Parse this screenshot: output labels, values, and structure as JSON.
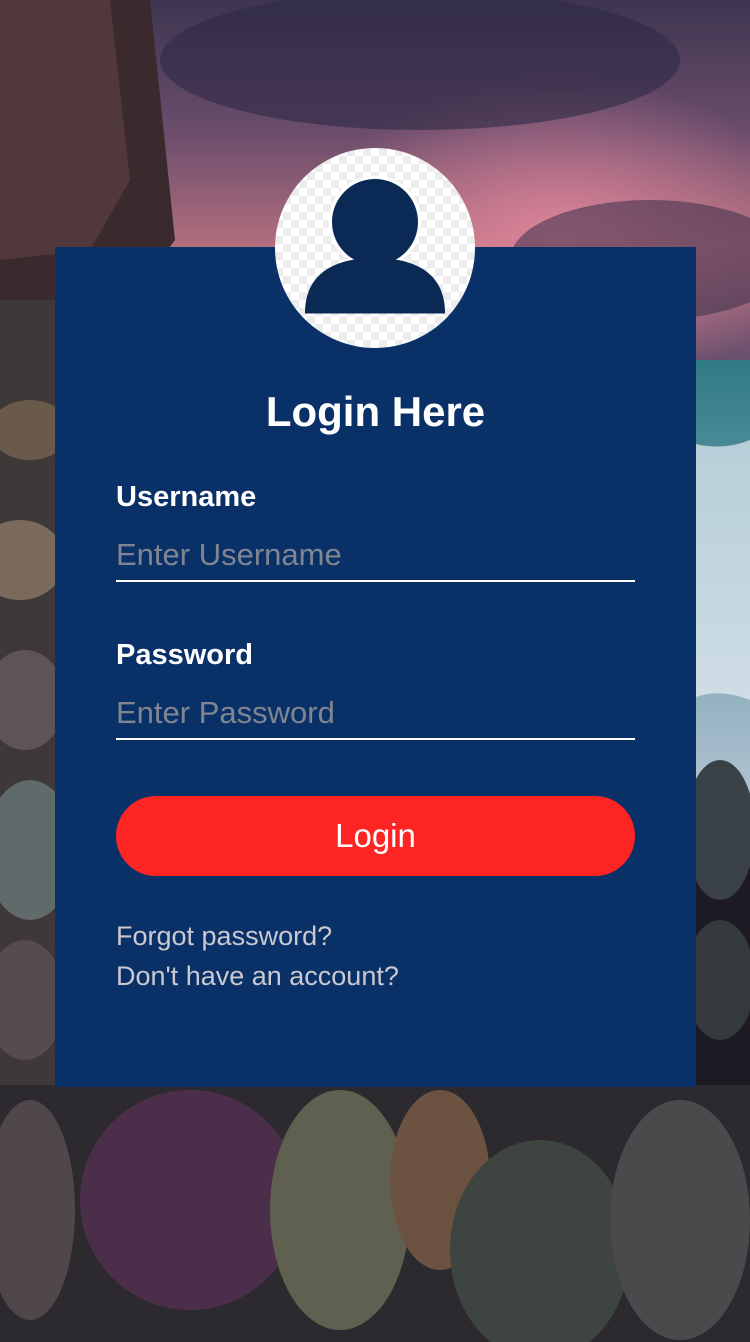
{
  "form": {
    "title": "Login Here",
    "username": {
      "label": "Username",
      "placeholder": "Enter Username"
    },
    "password": {
      "label": "Password",
      "placeholder": "Enter Password"
    },
    "submit_label": "Login",
    "forgot_link": "Forgot password?",
    "signup_link": "Don't have an account?"
  },
  "colors": {
    "card": "#0a3068",
    "button": "#fd2424",
    "avatar_icon": "#0a2a55",
    "link": "#c9c9cf"
  },
  "icons": {
    "avatar": "user-avatar-icon"
  }
}
